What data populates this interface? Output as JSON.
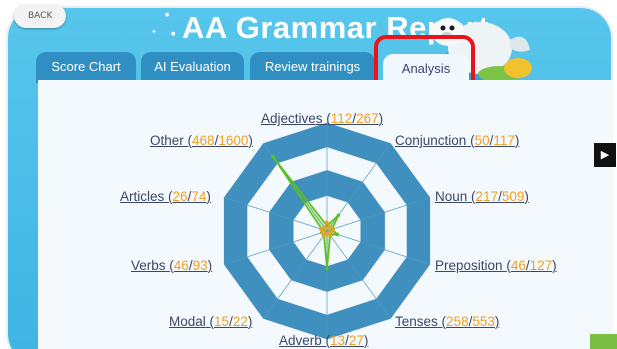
{
  "app": {
    "back_label": "BACK",
    "title": "AA Grammar Report"
  },
  "tabs": [
    {
      "label": "Score Chart",
      "active": false
    },
    {
      "label": "AI Evaluation",
      "active": false
    },
    {
      "label": "Review trainings",
      "active": false
    },
    {
      "label": "Analysis",
      "active": true
    }
  ],
  "colors": {
    "header_blue": "#3fb4e3",
    "tab_blue": "#2f8fc2",
    "radar_fill": "#3f8fbf",
    "highlight_red": "#e8141b",
    "count_orange": "#f0a020",
    "series_green": "#5bbf1e",
    "series_orange": "#f0a020"
  },
  "chart_data": {
    "type": "radar",
    "title": "",
    "axes": [
      {
        "name": "Adjectives",
        "correct": 112,
        "total": 267
      },
      {
        "name": "Conjunction",
        "correct": 50,
        "total": 117
      },
      {
        "name": "Noun",
        "correct": 217,
        "total": 509
      },
      {
        "name": "Preposition",
        "correct": 46,
        "total": 127
      },
      {
        "name": "Tenses",
        "correct": 258,
        "total": 553
      },
      {
        "name": "Adverb",
        "correct": 13,
        "total": 27
      },
      {
        "name": "Modal",
        "correct": 15,
        "total": 22
      },
      {
        "name": "Verbs",
        "correct": 46,
        "total": 93
      },
      {
        "name": "Articles",
        "correct": 26,
        "total": 74
      },
      {
        "name": "Other",
        "correct": 468,
        "total": 1600
      }
    ],
    "series": [
      {
        "values": [
          0.05,
          0.18,
          0.05,
          0.1,
          0.05,
          0.35,
          0.05,
          0.05,
          0.05,
          0.85
        ]
      },
      {
        "values": [
          0.08,
          0.05,
          0.06,
          0.04,
          0.05,
          0.03,
          0.05,
          0.04,
          0.06,
          0.04
        ]
      }
    ]
  },
  "player": {
    "play_icon": "play-icon"
  }
}
